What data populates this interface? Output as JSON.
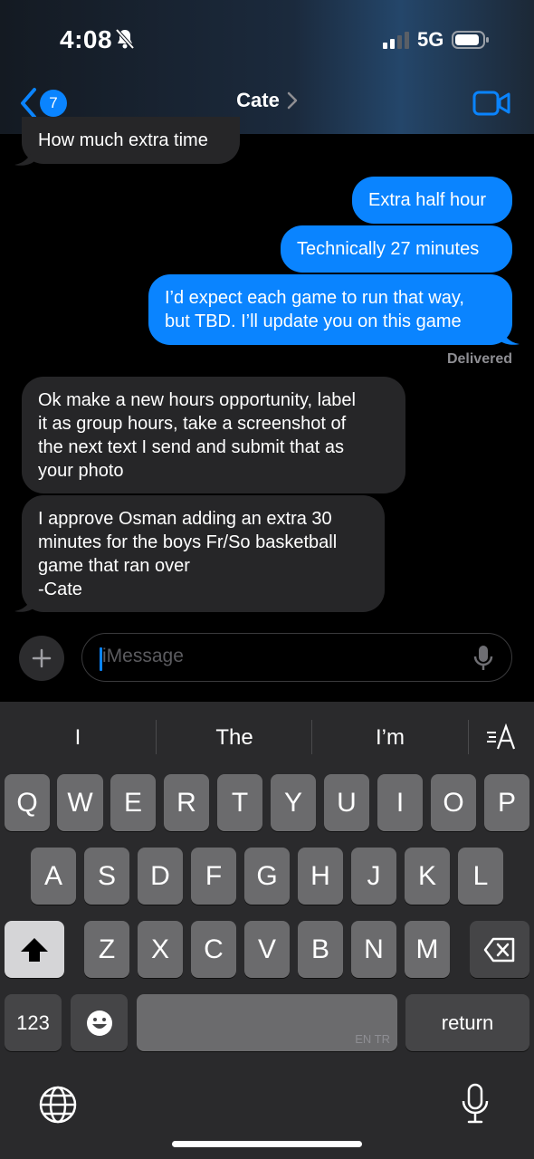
{
  "status_bar": {
    "time": "4:08",
    "network": "5G"
  },
  "nav": {
    "back_badge": "7",
    "contact_name": "Cate"
  },
  "messages": {
    "m0": [
      "How much extra time"
    ],
    "m1": [
      "Extra half hour"
    ],
    "m2": [
      "Technically 27 minutes"
    ],
    "m3": [
      "I’d expect each game to run that way,",
      "but TBD. I’ll update you on this game"
    ],
    "delivered": "Delivered",
    "m4": [
      "Ok make a new hours opportunity, label",
      "it as group hours, take a screenshot of",
      "the next text I send and submit that as",
      "your photo"
    ],
    "m5": [
      "I approve Osman adding an extra 30",
      "minutes for the boys Fr/So basketball",
      "game that ran over",
      "-Cate"
    ]
  },
  "composer": {
    "placeholder": "iMessage"
  },
  "keyboard": {
    "suggestions": [
      "I",
      "The",
      "I’m"
    ],
    "row1": [
      "Q",
      "W",
      "E",
      "R",
      "T",
      "Y",
      "U",
      "I",
      "O",
      "P"
    ],
    "row2": [
      "A",
      "S",
      "D",
      "F",
      "G",
      "H",
      "J",
      "K",
      "L"
    ],
    "row3": [
      "Z",
      "X",
      "C",
      "V",
      "B",
      "N",
      "M"
    ],
    "numbers_label": "123",
    "space_hint": "EN TR",
    "return_label": "return"
  },
  "colors": {
    "accent": "#0a84ff",
    "incoming": "#262628",
    "background": "#000000",
    "keyboard": "#2a2a2c"
  }
}
